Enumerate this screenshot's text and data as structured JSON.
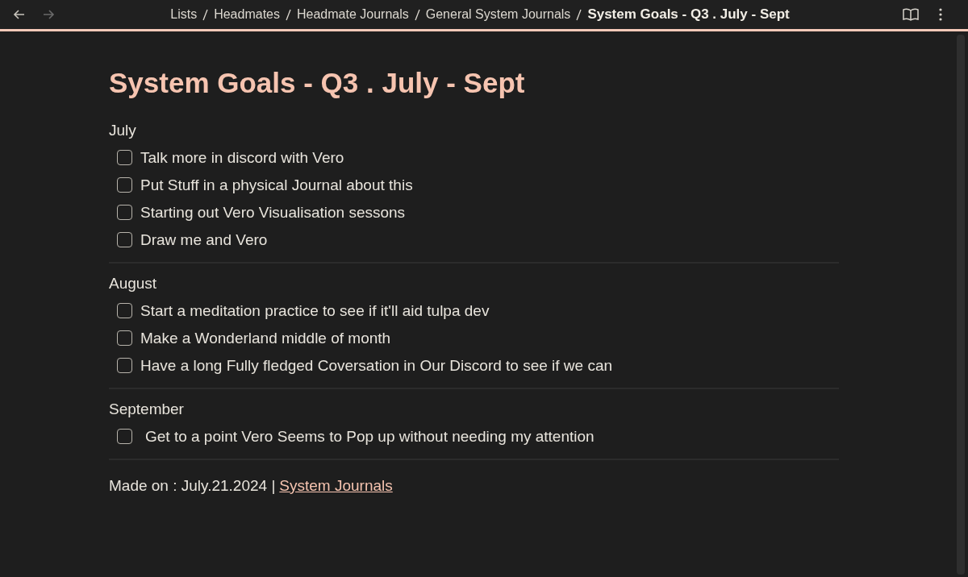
{
  "nav": {
    "back_enabled": true,
    "forward_enabled": false
  },
  "breadcrumbs": [
    "Lists",
    "Headmates",
    "Headmate Journals",
    "General System Journals"
  ],
  "current_page": "System Goals - Q3 . July - Sept",
  "title": "System Goals - Q3 . July - Sept",
  "sections": [
    {
      "heading": "July",
      "tasks": [
        {
          "text": "Talk more in discord with Vero",
          "checked": false
        },
        {
          "text": "Put Stuff in a physical Journal about this",
          "checked": false
        },
        {
          "text": "Starting out Vero Visualisation sessons",
          "checked": false
        },
        {
          "text": "Draw me and Vero",
          "checked": false
        }
      ]
    },
    {
      "heading": "August",
      "tasks": [
        {
          "text": "Start a meditation practice to see if it'll aid tulpa dev",
          "checked": false
        },
        {
          "text": "Make a Wonderland middle of month",
          "checked": false
        },
        {
          "text": "Have a long Fully fledged Coversation in Our Discord to see if we can",
          "checked": false
        }
      ]
    },
    {
      "heading": "September",
      "tasks": [
        {
          "text": "Get to a point Vero Seems to Pop up without needing my attention",
          "checked": false
        }
      ]
    }
  ],
  "footer": {
    "text": "Made on : July.21.2024 |",
    "link": "System Journals"
  }
}
